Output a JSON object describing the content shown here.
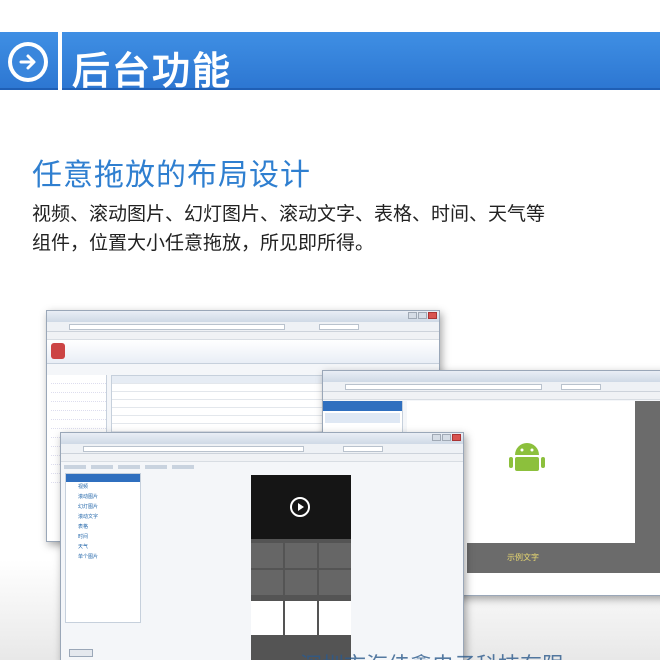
{
  "banner": {
    "title": "后台功能",
    "icon": "circle-arrow-right-icon",
    "color": "#3a86dc"
  },
  "section": {
    "heading": "任意拖放的布局设计",
    "description_line1": "视频、滚动图片、幻灯图片、滚动文字、表格、时间、天气等",
    "description_line2": "组件，位置大小任意拖放，所见即所得。"
  },
  "screenshots": {
    "window2": {
      "sample_text": "示例文字"
    },
    "window3": {
      "sidebar_items": [
        "视频",
        "滚动图片",
        "幻灯图片",
        "滚动文字",
        "表格",
        "时间",
        "天气",
        "单个图片"
      ]
    }
  },
  "watermark": "深圳市海佳鑫电子科技有限"
}
